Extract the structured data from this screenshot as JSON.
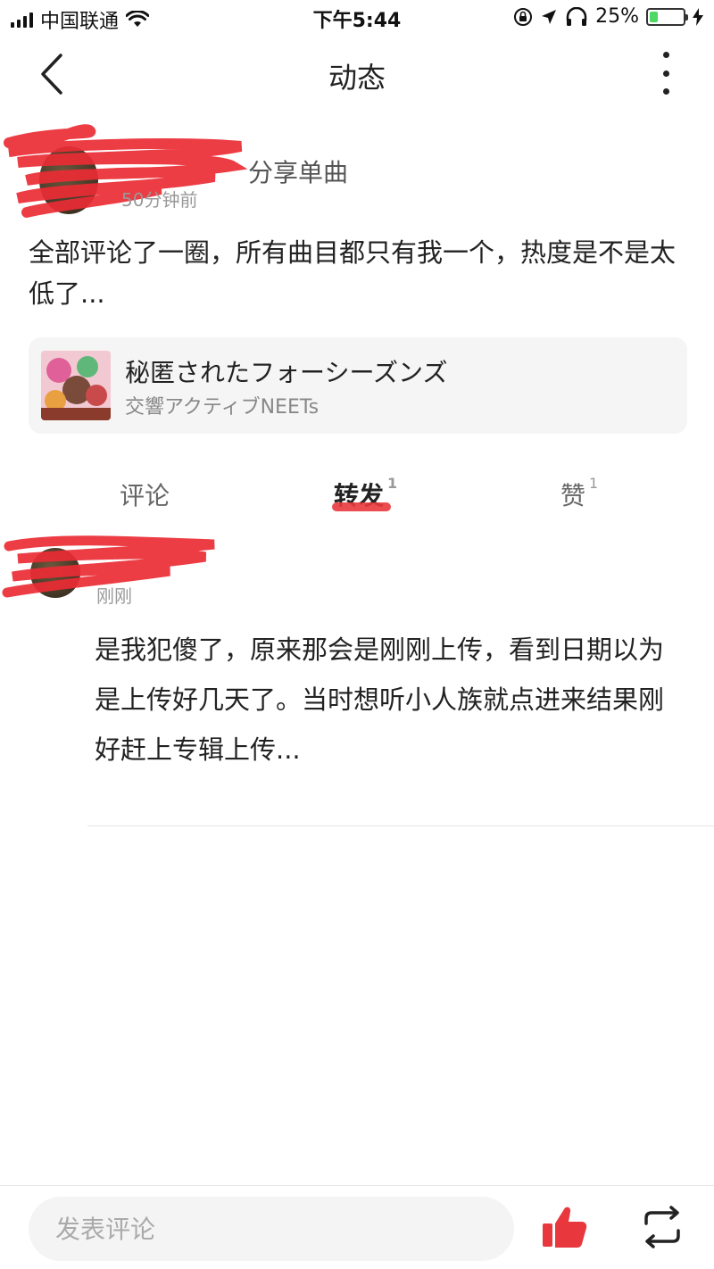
{
  "status_bar": {
    "carrier": "中国联通",
    "time": "下午5:44",
    "battery_percent": "25%",
    "battery_level": 0.25
  },
  "nav": {
    "title": "动态"
  },
  "post": {
    "action": "分享单曲",
    "time": "50分钟前",
    "text": "全部评论了一圈，所有曲目都只有我一个，热度是不是太低了..."
  },
  "song": {
    "title": "秘匿されたフォーシーズンズ",
    "artist": "交響アクティブNEETs"
  },
  "tabs": {
    "comments": {
      "label": "评论"
    },
    "forwards": {
      "label": "转发",
      "count": "1"
    },
    "likes": {
      "label": "赞",
      "count": "1"
    }
  },
  "forward_item": {
    "time": "刚刚",
    "text": "是我犯傻了，原来那会是刚刚上传，看到日期以为是上传好几天了。当时想听小人族就点进来结果刚好赶上专辑上传..."
  },
  "bottom_bar": {
    "input_placeholder": "发表评论"
  },
  "colors": {
    "accent": "#e8383d",
    "battery": "#4cd964"
  }
}
